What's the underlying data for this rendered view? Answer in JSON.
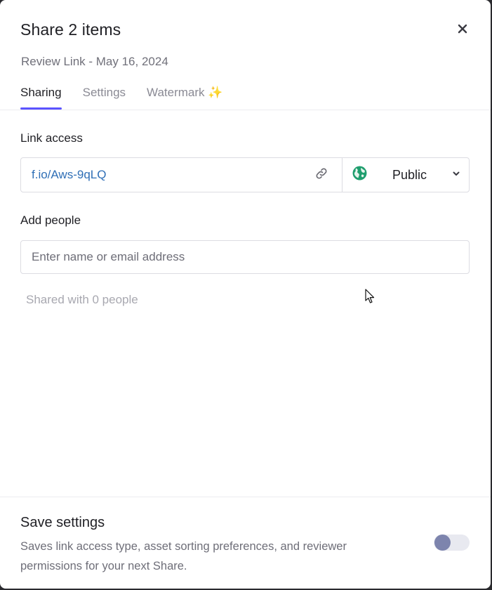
{
  "dialog": {
    "title": "Share 2 items",
    "subtitle": "Review Link - May 16, 2024",
    "close_icon": "close-icon"
  },
  "tabs": [
    {
      "label": "Sharing",
      "active": true
    },
    {
      "label": "Settings",
      "active": false
    },
    {
      "label": "Watermark ✨",
      "active": false
    }
  ],
  "link_access": {
    "label": "Link access",
    "url": "f.io/Aws-9qLQ",
    "copy_icon": "link-icon",
    "access_icon": "globe-icon",
    "access_value": "Public",
    "dropdown_icon": "chevron-down-icon"
  },
  "add_people": {
    "label": "Add people",
    "placeholder": "Enter name or email address",
    "value": ""
  },
  "shared_with": "Shared with 0 people",
  "save_settings": {
    "title": "Save settings",
    "description": "Saves link access type, asset sorting preferences, and reviewer permissions for your next Share.",
    "enabled": false
  },
  "colors": {
    "accent": "#5b53ff",
    "link": "#2f6fb6",
    "toggle_knob": "#7d84ad",
    "globe_land": "#1f9e6e"
  }
}
